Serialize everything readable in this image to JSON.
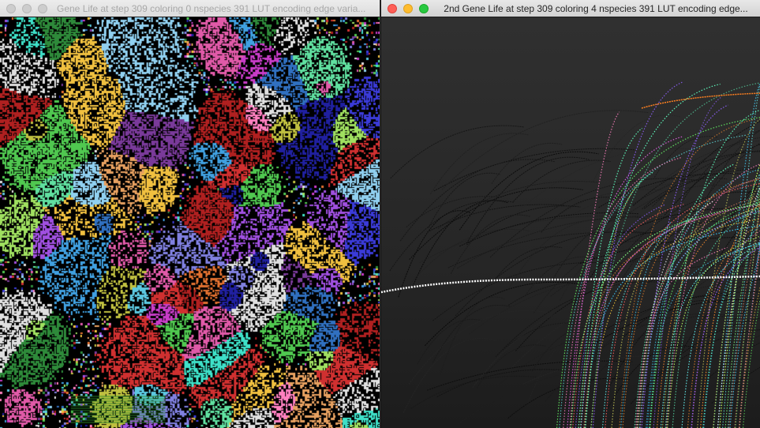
{
  "windows": {
    "left": {
      "title": "Gene Life at step 309 coloring 0 nspecies 391 LUT encoding edge varia...",
      "focused": false
    },
    "right": {
      "title": "2nd Gene Life at step 309 coloring 4 nspecies 391 LUT encoding edge...",
      "focused": true
    }
  },
  "colors": {
    "traffic_close": "#fe5f57",
    "traffic_minimize": "#febc2e",
    "traffic_zoom": "#28c840",
    "trace_highlight": "#ffffff"
  },
  "icons": {
    "close": "close-icon",
    "minimize": "minimize-icon",
    "zoom": "zoom-icon"
  }
}
